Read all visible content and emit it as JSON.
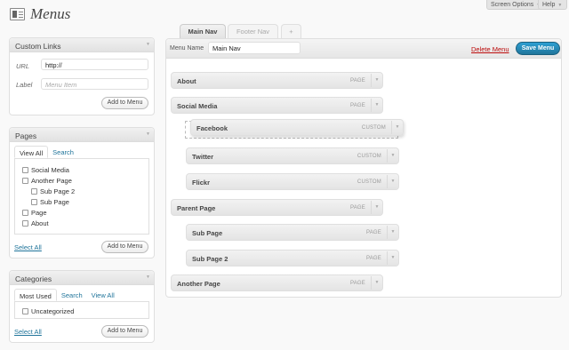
{
  "top_tabs": {
    "screen_options": "Screen Options",
    "help": "Help"
  },
  "page": {
    "title": "Menus"
  },
  "custom_links": {
    "title": "Custom Links",
    "url_label": "URL",
    "url_value": "http://",
    "label_label": "Label",
    "label_placeholder": "Menu Item",
    "add_button": "Add to Menu"
  },
  "pages_box": {
    "title": "Pages",
    "tabs": [
      "View All",
      "Search"
    ],
    "items": [
      "Social Media",
      "Another Page",
      "Sub Page 2",
      "Sub Page",
      "Page",
      "About"
    ],
    "select_all": "Select All",
    "add_button": "Add to Menu"
  },
  "categories_box": {
    "title": "Categories",
    "tabs": [
      "Most Used",
      "Search",
      "View All"
    ],
    "items": [
      "Uncategorized"
    ],
    "select_all": "Select All",
    "add_button": "Add to Menu"
  },
  "menu_tabs": [
    "Main Nav",
    "Footer Nav",
    "+"
  ],
  "editor": {
    "menu_name_label": "Menu Name",
    "menu_name_value": "Main Nav",
    "delete_label": "Delete Menu",
    "save_label": "Save Menu"
  },
  "menu_items": [
    {
      "title": "About",
      "type": "PAGE"
    },
    {
      "title": "Social Media",
      "type": "PAGE"
    },
    {
      "title": "Facebook",
      "type": "CUSTOM"
    },
    {
      "title": "Twitter",
      "type": "CUSTOM"
    },
    {
      "title": "Flickr",
      "type": "CUSTOM"
    },
    {
      "title": "Parent Page",
      "type": "PAGE"
    },
    {
      "title": "Sub Page",
      "type": "PAGE"
    },
    {
      "title": "Sub Page 2",
      "type": "PAGE"
    },
    {
      "title": "Another Page",
      "type": "PAGE"
    }
  ],
  "colors": {
    "link": "#21759b",
    "delete": "#bc0b0b",
    "primary_button": "#21759b"
  }
}
